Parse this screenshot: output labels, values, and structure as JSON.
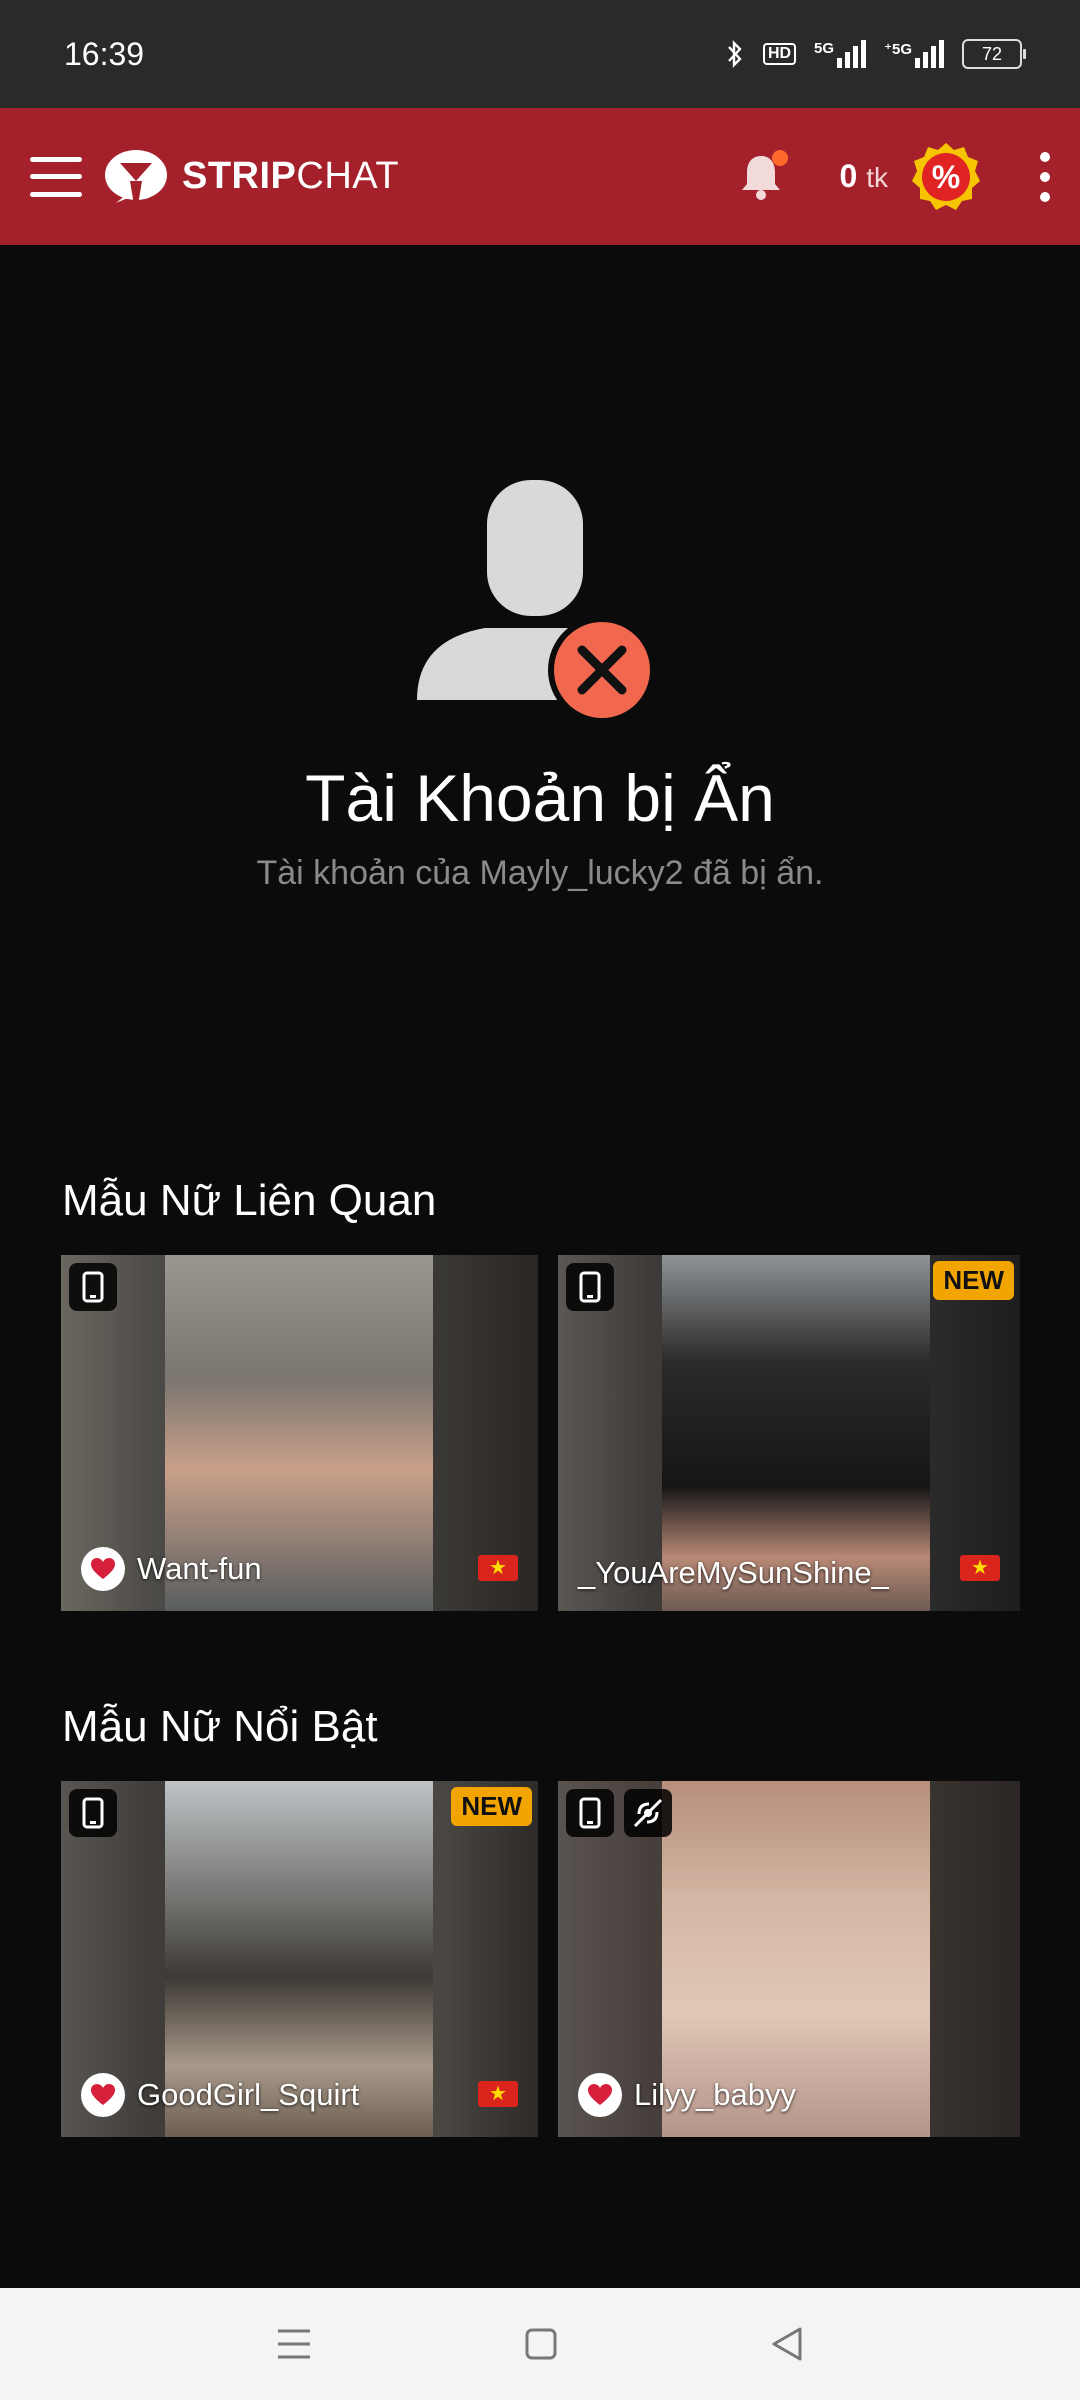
{
  "status_bar": {
    "time": "16:39",
    "network": "5G",
    "network2": "⁺5G",
    "hd": "HD",
    "battery": "72"
  },
  "header": {
    "brand_bold": "STRIP",
    "brand_light": "CHAT",
    "token_count": "0",
    "token_unit": "tk",
    "promo_symbol": "%",
    "brand_color": "#a4212b",
    "notification_dot_color": "#ff6a2c"
  },
  "hidden_account": {
    "title": "Tài Khoản bị Ẩn",
    "subtitle": "Tài khoản của Mayly_lucky2 đã bị ẩn.",
    "badge_color": "#f2684f"
  },
  "sections": {
    "related_title": "Mẫu Nữ Liên Quan",
    "featured_title": "Mẫu Nữ Nổi Bật"
  },
  "cards": [
    {
      "name": "Want-fun",
      "new": "",
      "flag": "★"
    },
    {
      "name": "_YouAreMySunShine_",
      "new": "NEW",
      "flag": "★"
    },
    {
      "name": "GoodGirl_Squirt",
      "new": "NEW",
      "flag": "★"
    },
    {
      "name": "Lilyy_babyy",
      "new": "",
      "flag": ""
    }
  ]
}
